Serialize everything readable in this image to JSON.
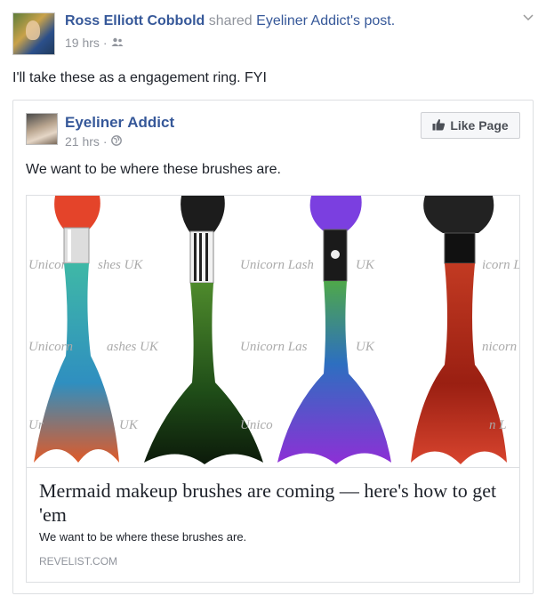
{
  "post": {
    "author": "Ross Elliott Cobbold",
    "shared_text": "shared",
    "source_post": "Eyeliner Addict's post.",
    "time": "19 hrs",
    "separator": "·",
    "audience_icon": "friends-icon",
    "text": "I'll take these as a engagement ring. FYI",
    "chevron_icon": "chevron-down-icon"
  },
  "shared_post": {
    "page_name": "Eyeliner Addict",
    "time": "21 hrs",
    "separator": "·",
    "audience_icon": "globe-icon",
    "like_button": "Like Page",
    "like_icon": "thumbs-up-icon",
    "text": "We want to be where these brushes are."
  },
  "link_preview": {
    "image_watermark": "Unicorn Lashes UK",
    "watermark_fragments": [
      "Unicor",
      "shes UK",
      "Unicorn Lash",
      "UK",
      "icorn L",
      "Unicorn",
      "ashes UK",
      "Unicorn Las",
      "UK",
      "nicorn L",
      "Ur",
      "UK",
      "Unico",
      "n L"
    ],
    "brush_colors": [
      "#d8442e",
      "#3a6b22",
      "#6a3fc8",
      "#b4311d"
    ],
    "title": "Mermaid makeup brushes are coming — here's how to get 'em",
    "description": "We want to be where these brushes are.",
    "domain": "REVELIST.COM"
  }
}
